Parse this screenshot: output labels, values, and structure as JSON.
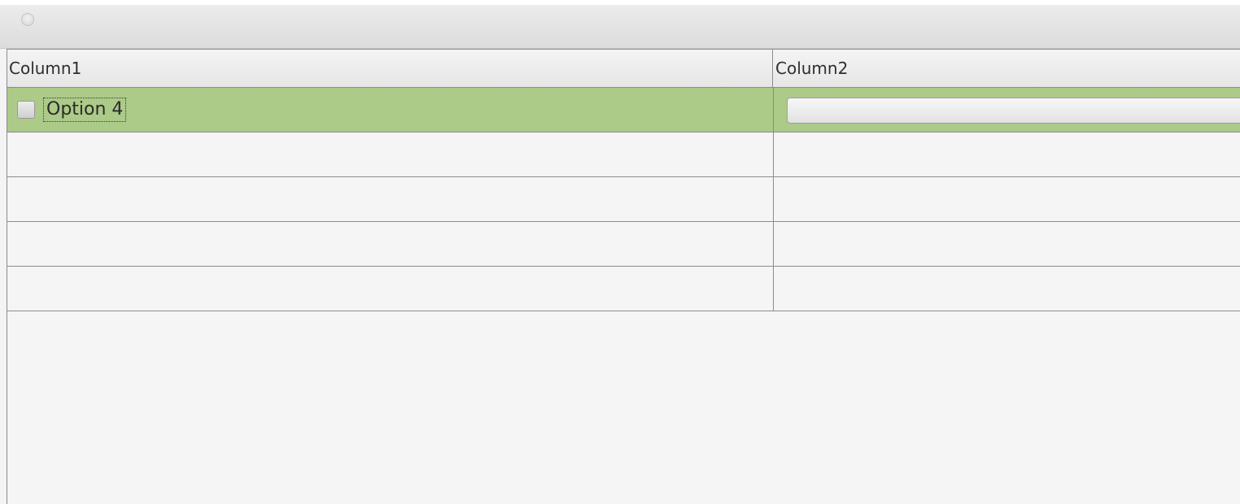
{
  "window": {
    "title": ""
  },
  "table": {
    "columns": [
      {
        "label": "Column1"
      },
      {
        "label": "Column2"
      }
    ],
    "rows": [
      {
        "checked": false,
        "label": "Option 4",
        "button_label": "",
        "selected": true
      },
      {
        "label": "",
        "selected": false
      },
      {
        "label": "",
        "selected": false
      },
      {
        "label": "",
        "selected": false
      },
      {
        "label": "",
        "selected": false
      }
    ]
  },
  "colors": {
    "selected_row": "#acca88",
    "grid_line": "#8c8c8c",
    "background": "#f5f5f5"
  },
  "icons": {
    "window_button": "circle-window-button-icon"
  }
}
